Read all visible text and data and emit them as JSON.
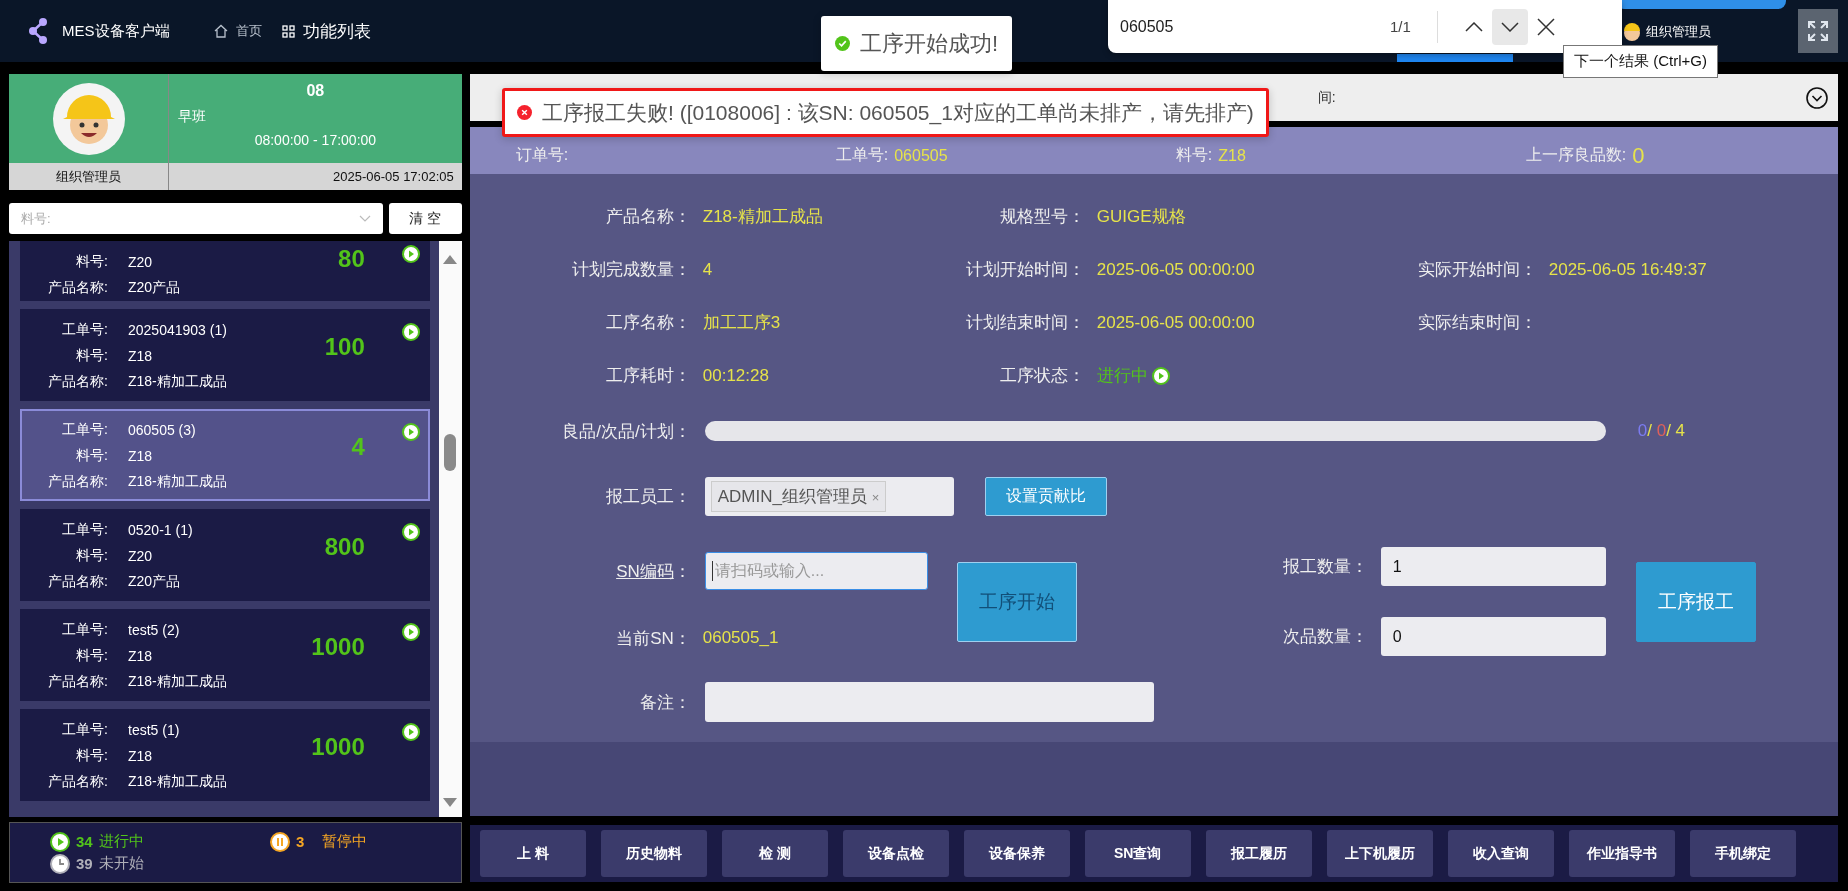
{
  "app": {
    "title": "MES设备客户端"
  },
  "nav": [
    {
      "label": "首页",
      "kind": "home",
      "selected": false
    },
    {
      "label": "功能列表",
      "kind": "grid",
      "selected": true
    }
  ],
  "user": {
    "name": "组织管理员"
  },
  "find_bar": {
    "query": "060505",
    "count": "1/1",
    "tooltip": "下一个结果 (Ctrl+G)"
  },
  "toasts": [
    {
      "kind": "success",
      "text": "工序开始成功!"
    },
    {
      "kind": "error",
      "text": "工序报工失败! ([0108006] : 该SN: 060505_1对应的工单尚未排产，请先排产)"
    }
  ],
  "operator": {
    "name": "组织管理员",
    "shift_code": "08",
    "shift": "早班",
    "hours": "08:00:00 - 17:00:00",
    "datetime": "2025-06-05 17:02:05"
  },
  "filter": {
    "placeholder": "料号:",
    "clear": "清 空"
  },
  "work_orders": [
    {
      "selected": false,
      "qty": "80",
      "fields": [
        {
          "label": "料号:",
          "value": "Z20"
        },
        {
          "label": "产品名称:",
          "value": "Z20产品"
        }
      ]
    },
    {
      "selected": false,
      "qty": "100",
      "fields": [
        {
          "label": "工单号:",
          "value": "2025041903 (1)"
        },
        {
          "label": "料号:",
          "value": "Z18"
        },
        {
          "label": "产品名称:",
          "value": "Z18-精加工成品"
        }
      ]
    },
    {
      "selected": true,
      "qty": "4",
      "fields": [
        {
          "label": "工单号:",
          "value": "060505 (3)"
        },
        {
          "label": "料号:",
          "value": "Z18"
        },
        {
          "label": "产品名称:",
          "value": "Z18-精加工成品"
        }
      ]
    },
    {
      "selected": false,
      "qty": "800",
      "fields": [
        {
          "label": "工单号:",
          "value": "0520-1 (1)"
        },
        {
          "label": "料号:",
          "value": "Z20"
        },
        {
          "label": "产品名称:",
          "value": "Z20产品"
        }
      ]
    },
    {
      "selected": false,
      "qty": "1000",
      "fields": [
        {
          "label": "工单号:",
          "value": "test5 (2)"
        },
        {
          "label": "料号:",
          "value": "Z18"
        },
        {
          "label": "产品名称:",
          "value": "Z18-精加工成品"
        }
      ]
    },
    {
      "selected": false,
      "qty": "1000",
      "fields": [
        {
          "label": "工单号:",
          "value": "test5 (1)"
        },
        {
          "label": "料号:",
          "value": "Z18"
        },
        {
          "label": "产品名称:",
          "value": "Z18-精加工成品"
        }
      ]
    }
  ],
  "stats": [
    {
      "kind": "running",
      "count": "34",
      "label": "进行中"
    },
    {
      "kind": "paused",
      "count": "3",
      "label": "暂停中"
    },
    {
      "kind": "pending",
      "count": "39",
      "label": "未开始"
    }
  ],
  "top_strip": {
    "text": "间:"
  },
  "header": [
    {
      "label": "订单号:"
    },
    {
      "label": "工单号:",
      "value": "060505"
    },
    {
      "label": "料号:",
      "value": "Z18"
    },
    {
      "label": "上一序良品数:",
      "value": "0"
    }
  ],
  "details": [
    [
      {
        "label": "产品名称：",
        "value": "Z18-精加工成品"
      },
      {
        "label": "规格型号：",
        "value": "GUIGE规格"
      }
    ],
    [
      {
        "label": "计划完成数量：",
        "value": "4"
      },
      {
        "label": "计划开始时间：",
        "value": "2025-06-05 00:00:00"
      },
      {
        "label": "实际开始时间：",
        "value": "2025-06-05 16:49:37"
      }
    ],
    [
      {
        "label": "工序名称：",
        "value": "加工工序3"
      },
      {
        "label": "计划结束时间：",
        "value": "2025-06-05 00:00:00"
      },
      {
        "label": "实际结束时间："
      }
    ],
    [
      {
        "label": "工序耗时：",
        "value": "00:12:28"
      },
      {
        "label": "工序状态：",
        "value": "进行中",
        "kind": "status"
      }
    ]
  ],
  "progress": {
    "label": "良品/次品/计划：",
    "level": 0,
    "counts": [
      {
        "text": "0",
        "color": "#7b7bf0"
      },
      {
        "text": "/ ",
        "color": "#e6e34a"
      },
      {
        "text": "0",
        "color": "#e0605a"
      },
      {
        "text": "/ 4",
        "color": "#e6e34a"
      }
    ]
  },
  "report": {
    "staff_label": "报工员工：",
    "staff_tag": "ADMIN_组织管理员",
    "tag_remove": "×",
    "ratio_button": "设置贡献比",
    "sn_label": "SN编码",
    "sn_colon": "：",
    "sn_placeholder": "请扫码或输入...",
    "current_sn_label": "当前SN：",
    "current_sn": "060505_1",
    "start_button": {
      "label": "工序开始",
      "disabled": true
    },
    "qty_label": "报工数量：",
    "qty": "1",
    "defect_label": "次品数量：",
    "defect": "0",
    "report_button": "工序报工",
    "note_label": "备注："
  },
  "toolbar": [
    "上 料",
    "历史物料",
    "检 测",
    "设备点检",
    "设备保养",
    "SN查询",
    "报工履历",
    "上下机履历",
    "收入查询",
    "作业指导书",
    "手机绑定"
  ]
}
